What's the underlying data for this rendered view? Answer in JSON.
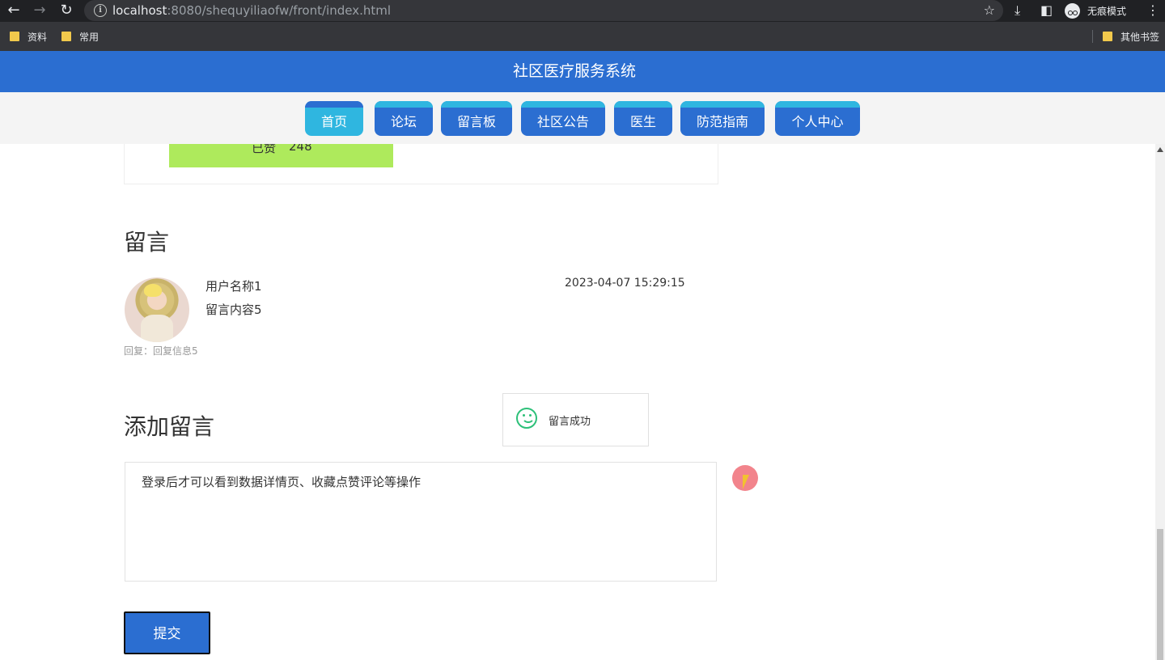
{
  "browser": {
    "url_host": "localhost",
    "url_rest": ":8080/shequyiliaofw/front/index.html",
    "incognito_label": "无痕模式",
    "bookmarks": [
      "资料",
      "常用"
    ],
    "other_bookmarks": "其他书签"
  },
  "header": {
    "title": "社区医疗服务系统"
  },
  "nav": {
    "items": [
      {
        "label": "首页",
        "active": true
      },
      {
        "label": "论坛"
      },
      {
        "label": "留言板"
      },
      {
        "label": "社区公告"
      },
      {
        "label": "医生"
      },
      {
        "label": "防范指南"
      },
      {
        "label": "个人中心"
      }
    ]
  },
  "liked": {
    "label": "已赞",
    "count": "248"
  },
  "messages": {
    "title": "留言",
    "items": [
      {
        "user": "用户名称1",
        "content": "留言内容5",
        "time": "2023-04-07 15:29:15",
        "reply": "回复：回复信息5"
      }
    ]
  },
  "add_message": {
    "title": "添加留言",
    "textarea_value": "登录后才可以看到数据详情页、收藏点赞评论等操作",
    "submit_label": "提交"
  },
  "toast": {
    "text": "留言成功",
    "icon": "smile-icon"
  },
  "colors": {
    "primary": "#2b6ed1",
    "tab_accent": "#2fb6e0",
    "liked_bg": "#aeea5c",
    "success": "#2dc079"
  }
}
